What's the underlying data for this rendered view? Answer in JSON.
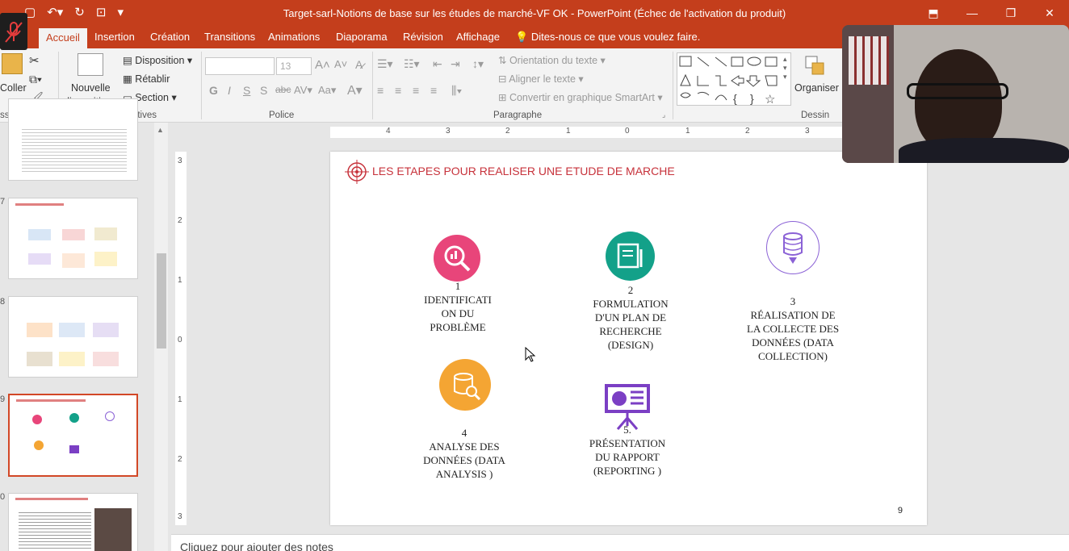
{
  "window": {
    "title": "Target-sarl-Notions de base sur les études de marché-VF OK - PowerPoint (Échec de l'activation du produit)",
    "controls": [
      "minimize-icon",
      "restore-icon",
      "close-icon"
    ]
  },
  "quick_access": [
    "save-icon",
    "undo-icon",
    "redo-icon",
    "present-icon",
    "customize-icon"
  ],
  "tabs": [
    "Accueil",
    "Insertion",
    "Création",
    "Transitions",
    "Animations",
    "Diaporama",
    "Révision",
    "Affichage"
  ],
  "tell_me": "Dites-nous ce que vous voulez faire.",
  "ribbon": {
    "clipboard": {
      "paste": "Coller",
      "group": "sse-papi..."
    },
    "slides": {
      "new_slide_1": "Nouvelle",
      "new_slide_2": "diapositive",
      "layout": "Disposition",
      "reset": "Rétablir",
      "section": "Section",
      "group": "Diapositives"
    },
    "font": {
      "font_size": "13",
      "group": "Police"
    },
    "paragraph": {
      "text_direction": "Orientation du texte",
      "align_text": "Aligner le texte",
      "smartart": "Convertir en graphique SmartArt",
      "group": "Paragraphe"
    },
    "drawing": {
      "arrange": "Organiser",
      "group": "Dessin"
    }
  },
  "thumbnails": [
    {
      "num": "",
      "selected": false
    },
    {
      "num": "7",
      "selected": false
    },
    {
      "num": "8",
      "selected": false
    },
    {
      "num": "9",
      "selected": true
    },
    {
      "num": "0",
      "selected": false
    }
  ],
  "ruler": {
    "h": [
      "4",
      "3",
      "2",
      "1",
      "0",
      "1",
      "2",
      "3"
    ],
    "v": [
      "3",
      "2",
      "1",
      "0",
      "1",
      "2",
      "3"
    ]
  },
  "slide": {
    "title": "LES ETAPES POUR REALISER UNE ETUDE DE MARCHE",
    "page_number": "9",
    "steps": [
      {
        "num": "1",
        "line1": "IDENTIFICATI",
        "line2": "ON DU",
        "line3": "PROBLÈME",
        "line4": "",
        "color": "#e8457a",
        "icon": "search-chart-icon"
      },
      {
        "num": "2",
        "line1": "FORMULATION",
        "line2": "D'UN PLAN DE",
        "line3": "RECHERCHE",
        "line4": "(DESIGN)",
        "color": "#13a189",
        "icon": "plan-pen-icon"
      },
      {
        "num": "3",
        "line1": "RÉALISATION DE",
        "line2": "LA COLLECTE DES",
        "line3": "DONNÉES (DATA",
        "line4": "COLLECTION)",
        "color": "#8b62d6",
        "icon": "database-download-icon"
      },
      {
        "num": "4",
        "line1": "ANALYSE DES",
        "line2": "DONNÉES (DATA",
        "line3": "ANALYSIS )",
        "line4": "",
        "color": "#f4a533",
        "icon": "database-search-icon"
      },
      {
        "num": "5.",
        "line1": "PRÉSENTATION",
        "line2": "DU RAPPORT",
        "line3": "(REPORTING )",
        "line4": "",
        "color": "#7b3fc4",
        "icon": "presentation-board-icon"
      }
    ]
  },
  "notes_placeholder": "Cliquez pour ajouter des notes",
  "colors": {
    "accent": "#c43e1c",
    "slide_title": "#c7323b"
  }
}
